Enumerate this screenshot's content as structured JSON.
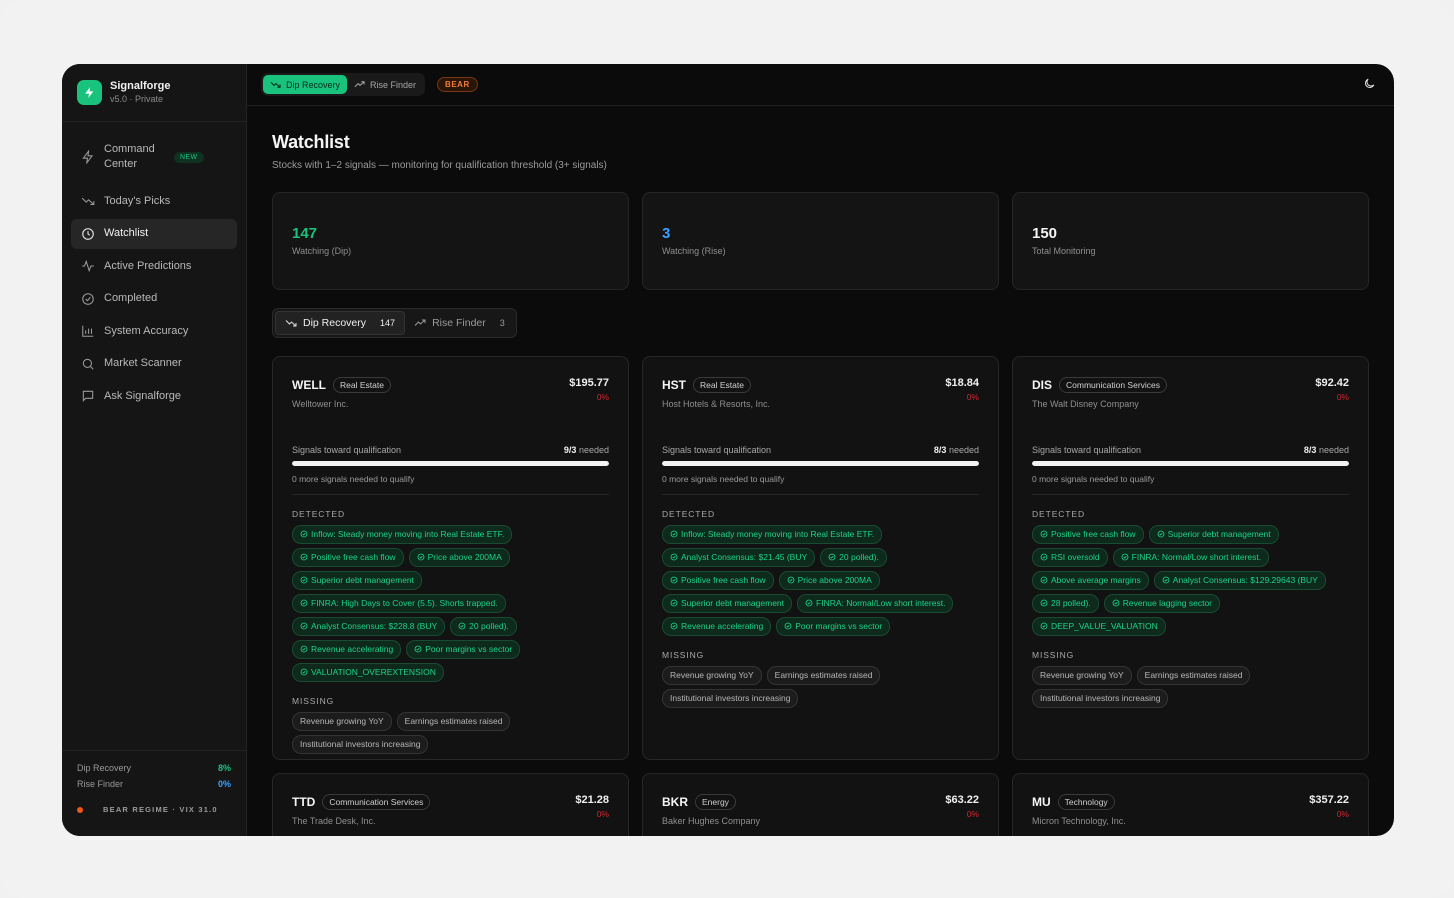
{
  "app": {
    "name": "Signalforge",
    "version": "v5.0 · Private"
  },
  "sidebar": {
    "items": [
      {
        "label": "Command Center",
        "badge": "NEW",
        "icon": "bolt-icon"
      },
      {
        "label": "Today's Picks",
        "icon": "trend-down-icon"
      },
      {
        "label": "Watchlist",
        "icon": "clock-icon",
        "active": true
      },
      {
        "label": "Active Predictions",
        "icon": "pulse-icon"
      },
      {
        "label": "Completed",
        "icon": "check-circle-icon"
      },
      {
        "label": "System Accuracy",
        "icon": "bar-chart-icon"
      },
      {
        "label": "Market Scanner",
        "icon": "search-icon"
      },
      {
        "label": "Ask Signalforge",
        "icon": "chat-icon"
      }
    ],
    "footer": {
      "dip_label": "Dip Recovery",
      "dip_value": "8%",
      "rise_label": "Rise Finder",
      "rise_value": "0%",
      "regime": "BEAR REGIME · VIX 31.0"
    }
  },
  "topbar": {
    "modes": [
      {
        "label": "Dip Recovery",
        "active": true
      },
      {
        "label": "Rise Finder"
      }
    ],
    "regime_badge": "BEAR"
  },
  "page": {
    "title": "Watchlist",
    "subtitle": "Stocks with 1–2 signals — monitoring for qualification threshold (3+ signals)"
  },
  "stats": [
    {
      "value": "147",
      "label": "Watching (Dip)",
      "color": "#19c37d"
    },
    {
      "value": "3",
      "label": "Watching (Rise)",
      "color": "#3aa0ff"
    },
    {
      "value": "150",
      "label": "Total Monitoring",
      "color": "#f5f5f5"
    }
  ],
  "tabs": [
    {
      "label": "Dip Recovery",
      "count": "147",
      "active": true
    },
    {
      "label": "Rise Finder",
      "count": "3"
    }
  ],
  "labels": {
    "progress": "Signals toward qualification",
    "needed": "needed",
    "detected": "DETECTED",
    "missing": "MISSING"
  },
  "cards": [
    {
      "ticker": "WELL",
      "sector": "Real Estate",
      "company": "Welltower Inc.",
      "price": "$195.77",
      "change": "0%",
      "signals": "9/3",
      "progress": 1.0,
      "note": "0 more signals needed to qualify",
      "detected": [
        "Inflow: Steady money moving into Real Estate ETF.",
        "Positive free cash flow",
        "Price above 200MA",
        "Superior debt management",
        "FINRA: High Days to Cover (5.5). Shorts trapped.",
        "Analyst Consensus: $228.8 (BUY",
        "20 polled).",
        "Revenue accelerating",
        "Poor margins vs sector",
        "VALUATION_OVEREXTENSION"
      ],
      "missing": [
        "Revenue growing YoY",
        "Earnings estimates raised",
        "Institutional investors increasing"
      ]
    },
    {
      "ticker": "HST",
      "sector": "Real Estate",
      "company": "Host Hotels & Resorts, Inc.",
      "price": "$18.84",
      "change": "0%",
      "signals": "8/3",
      "progress": 1.0,
      "note": "0 more signals needed to qualify",
      "detected": [
        "Inflow: Steady money moving into Real Estate ETF.",
        "Analyst Consensus: $21.45 (BUY",
        "20 polled).",
        "Positive free cash flow",
        "Price above 200MA",
        "Superior debt management",
        "FINRA: Normal/Low short interest.",
        "Revenue accelerating",
        "Poor margins vs sector"
      ],
      "missing": [
        "Revenue growing YoY",
        "Earnings estimates raised",
        "Institutional investors increasing"
      ]
    },
    {
      "ticker": "DIS",
      "sector": "Communication Services",
      "company": "The Walt Disney Company",
      "price": "$92.42",
      "change": "0%",
      "signals": "8/3",
      "progress": 1.0,
      "note": "0 more signals needed to qualify",
      "detected": [
        "Positive free cash flow",
        "Superior debt management",
        "RSI oversold",
        "FINRA: Normal/Low short interest.",
        "Above average margins",
        "Analyst Consensus: $129.29643 (BUY",
        "28 polled).",
        "Revenue lagging sector",
        "DEEP_VALUE_VALUATION"
      ],
      "missing": [
        "Revenue growing YoY",
        "Earnings estimates raised",
        "Institutional investors increasing"
      ]
    },
    {
      "ticker": "TTD",
      "sector": "Communication Services",
      "company": "The Trade Desk, Inc.",
      "price": "$21.28",
      "change": "0%"
    },
    {
      "ticker": "BKR",
      "sector": "Energy",
      "company": "Baker Hughes Company",
      "price": "$63.22",
      "change": "0%"
    },
    {
      "ticker": "MU",
      "sector": "Technology",
      "company": "Micron Technology, Inc.",
      "price": "$357.22",
      "change": "0%"
    }
  ]
}
